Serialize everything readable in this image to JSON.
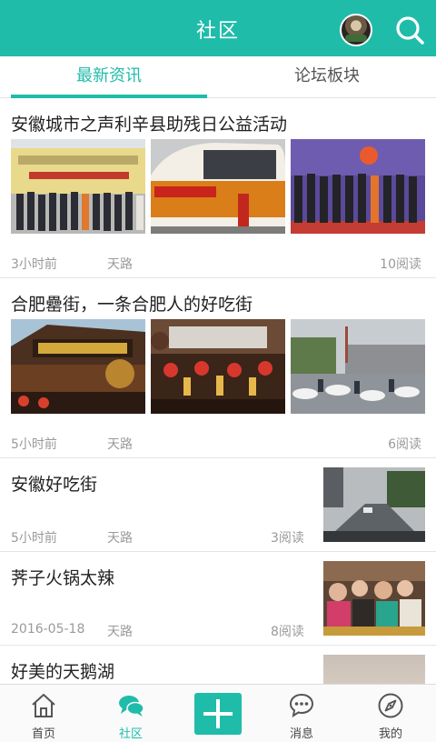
{
  "header": {
    "title": "社区"
  },
  "tabs": [
    {
      "label": "最新资讯",
      "active": true
    },
    {
      "label": "论坛板块",
      "active": false
    }
  ],
  "posts": [
    {
      "title": "安徽城市之声利辛县助残日公益活动",
      "time": "3小时前",
      "author": "天路",
      "reads": "10阅读"
    },
    {
      "title": "合肥罍街，一条合肥人的好吃街",
      "time": "5小时前",
      "author": "天路",
      "reads": "6阅读"
    },
    {
      "title": "安徽好吃街",
      "time": "5小时前",
      "author": "天路",
      "reads": "3阅读"
    },
    {
      "title": "荠子火锅太辣",
      "time": "2016-05-18",
      "author": "天路",
      "reads": "8阅读"
    },
    {
      "title": "好美的天鹅湖"
    }
  ],
  "nav": [
    {
      "label": "首页",
      "icon": "home-icon"
    },
    {
      "label": "社区",
      "icon": "chat-bubbles-icon",
      "active": true
    },
    {
      "label": "",
      "icon": "plus-icon"
    },
    {
      "label": "消息",
      "icon": "message-icon"
    },
    {
      "label": "我的",
      "icon": "compass-icon"
    }
  ],
  "colors": {
    "accent": "#1fbcaa",
    "meta_text": "#9a9a9a"
  }
}
